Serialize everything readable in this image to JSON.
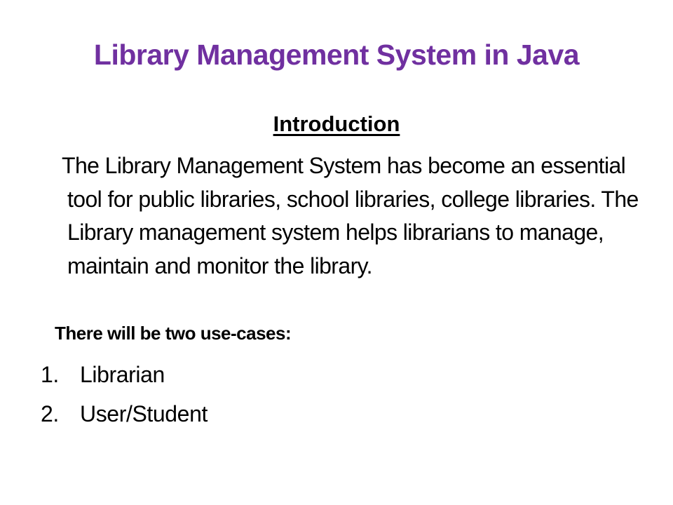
{
  "slide": {
    "title": "Library Management System in Java",
    "title_color": "#7030a0",
    "heading": "Introduction",
    "intro": "The Library Management System has become an essential tool for public libraries, school libraries, college libraries. The Library management system helps librarians to manage, maintain and monitor the library.",
    "usecase_lead": "There will be two use-cases:",
    "usecases": [
      {
        "number": "1.",
        "label": "Librarian"
      },
      {
        "number": "2.",
        "label": "User/Student"
      }
    ]
  }
}
